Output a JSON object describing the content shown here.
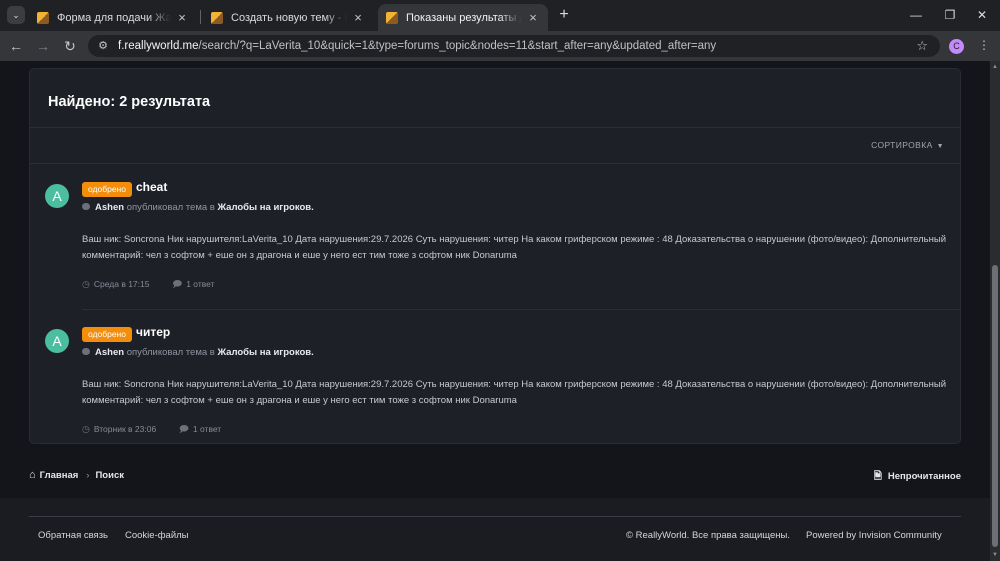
{
  "browser": {
    "tabs": [
      {
        "title": "Форма для подачи Жалобы на",
        "active": false
      },
      {
        "title": "Создать новую тему - ReallyWo",
        "active": false
      },
      {
        "title": "Показаны результаты для 'LaVe",
        "active": true
      }
    ],
    "url_host": "f.reallyworld.me",
    "url_path": "/search/?q=LaVerita_10&quick=1&type=forums_topic&nodes=11&start_after=any&updated_after=any",
    "profile_initial": "C",
    "profile_color": "#c58af9"
  },
  "search": {
    "heading": "Найдено: 2 результата",
    "sort_label": "СОРТИРОВКА"
  },
  "results": [
    {
      "avatar_letter": "A",
      "badge": "одобрено",
      "title": "cheat",
      "author": "Ashen",
      "published_text": "опубликовал тема в",
      "forum": "Жалобы на игроков.",
      "snippet": "Ваш ник: Soncrona Ник нарушителя:LaVerita_10 Дата нарушения:29.7.2026 Суть нарушения: читер На каком гриферском режиме : 48 Доказательства о нарушении (фото/видео): Дополнительный комментарий: чел з софтом + еше он з драгона и еше у него ест тим тоже з софтом ник Donaruma",
      "date": "Среда в 17:15",
      "replies": "1 ответ"
    },
    {
      "avatar_letter": "A",
      "badge": "одобрено",
      "title": "читер",
      "author": "Ashen",
      "published_text": "опубликовал тема в",
      "forum": "Жалобы на игроков.",
      "snippet": "Ваш ник: Soncrona Ник нарушителя:LaVerita_10 Дата нарушения:29.7.2026 Суть нарушения: читер На каком гриферском режиме : 48 Доказательства о нарушении (фото/видео): Дополнительный комментарий: чел з софтом + еше он з драгона и еше у него ест тим тоже з софтом ник Donaruma",
      "date": "Вторник в 23:06",
      "replies": "1 ответ"
    }
  ],
  "breadcrumb": {
    "home": "Главная",
    "current": "Поиск",
    "unread": "Непрочитанное"
  },
  "footer": {
    "feedback": "Обратная связь",
    "cookies": "Cookie-файлы",
    "copyright": "© ReallyWorld. Все права защищены.",
    "powered": "Powered by Invision Community"
  },
  "colors": {
    "badge_approved": "#f28e0c",
    "avatar": "#4bbda1",
    "card_bg": "#1e2028",
    "page_bg": "#14151a"
  }
}
